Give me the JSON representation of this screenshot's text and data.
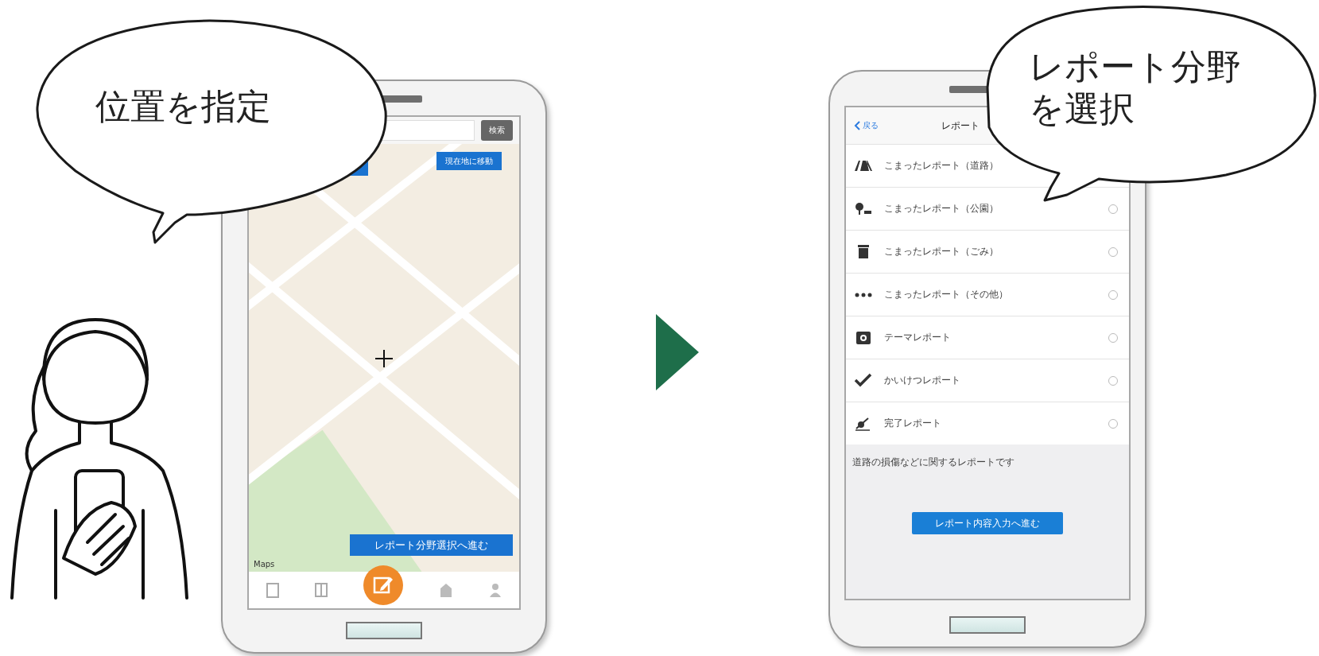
{
  "callouts": [
    {
      "text": "位置を指定"
    },
    {
      "text": "レポート分野を選択"
    }
  ],
  "map_screen": {
    "search_button": "検索",
    "locate_button": "現在地に移動",
    "next_button": "レポート分野選択へ進む",
    "map_credit": "Maps"
  },
  "category_screen": {
    "back_link": "戻る",
    "title": "レポート",
    "categories": [
      {
        "kind": "road",
        "label": "こまったレポート（道路）"
      },
      {
        "kind": "park",
        "label": "こまったレポート（公園）",
        "selected": false
      },
      {
        "kind": "trash",
        "label": "こまったレポート（ごみ）",
        "selected": false
      },
      {
        "kind": "other",
        "label": "こまったレポート（その他）",
        "selected": false
      },
      {
        "kind": "camera",
        "label": "テーマレポート",
        "selected": false
      },
      {
        "kind": "check",
        "label": "かいけつレポート",
        "selected": false
      },
      {
        "kind": "done",
        "label": "完了レポート",
        "selected": false
      }
    ],
    "description": "道路の損傷などに関するレポートです",
    "next_button": "レポート内容入力へ進む"
  }
}
